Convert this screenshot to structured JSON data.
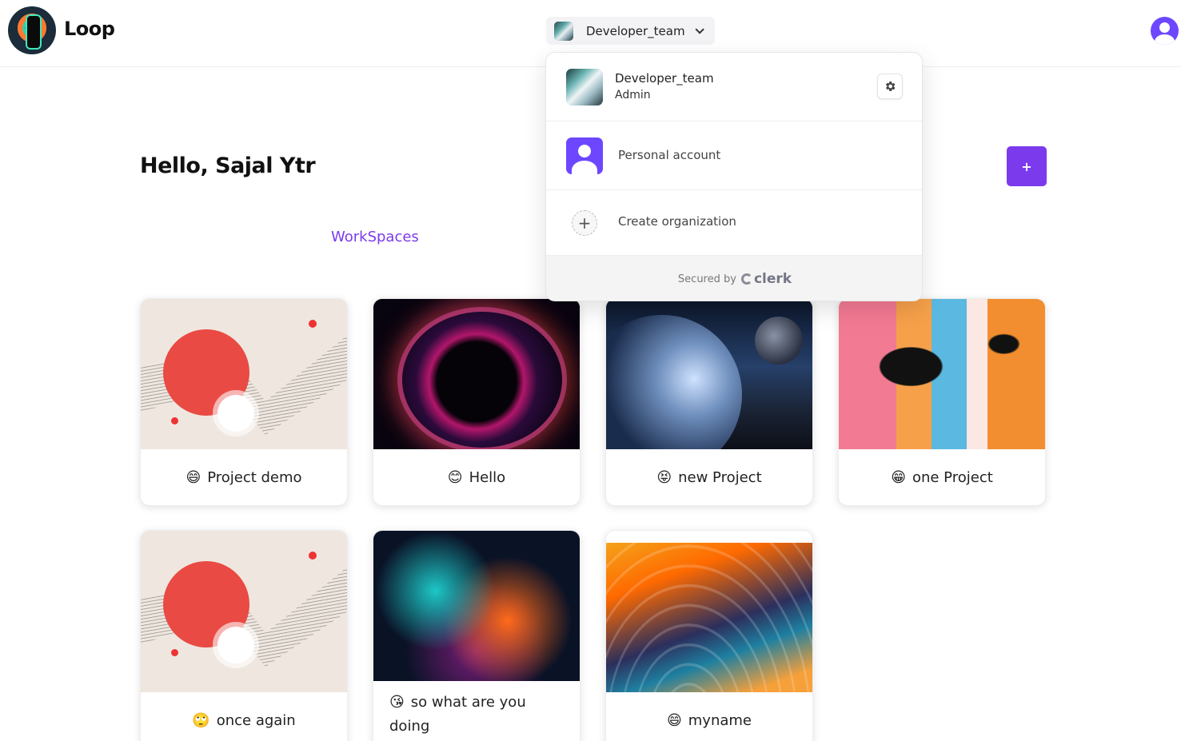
{
  "app": {
    "name": "Loop"
  },
  "org_switcher": {
    "current": "Developer_team"
  },
  "greeting": "Hello, Sajal Ytr",
  "add_button": {
    "label": "+"
  },
  "tabs": {
    "workspaces": "WorkSpaces"
  },
  "workspaces": [
    {
      "emoji": "😄",
      "title": "Project demo"
    },
    {
      "emoji": "😊",
      "title": "Hello"
    },
    {
      "emoji": "😝",
      "title": "new Project"
    },
    {
      "emoji": "😁",
      "title": "one Project"
    },
    {
      "emoji": "🙄",
      "title": "once again"
    },
    {
      "emoji": "😘",
      "title": "so what are you doing"
    },
    {
      "emoji": "😄",
      "title": "myname"
    }
  ],
  "dropdown": {
    "active_org": {
      "name": "Developer_team",
      "role": "Admin"
    },
    "personal_account": "Personal account",
    "create_org": "Create organization",
    "create_icon": "+",
    "footer": {
      "secured_by": "Secured by",
      "brand": "clerk"
    }
  },
  "colors": {
    "accent": "#7c3aed",
    "avatar": "#6c47ff"
  }
}
